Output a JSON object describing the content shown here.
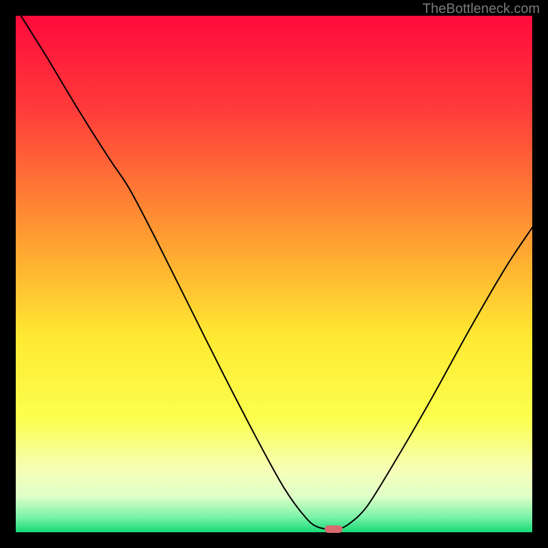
{
  "watermark": "TheBottleneck.com",
  "chart_data": {
    "type": "line",
    "title": "",
    "xlabel": "",
    "ylabel": "",
    "xlim": [
      0,
      100
    ],
    "ylim": [
      0,
      100
    ],
    "gradient_stops": [
      {
        "offset": 0,
        "color": "#ff0a3c"
      },
      {
        "offset": 18,
        "color": "#ff3b3a"
      },
      {
        "offset": 45,
        "color": "#ffa531"
      },
      {
        "offset": 62,
        "color": "#ffe932"
      },
      {
        "offset": 78,
        "color": "#fbff4e"
      },
      {
        "offset": 88,
        "color": "#f6ffb8"
      },
      {
        "offset": 93,
        "color": "#e0ffc8"
      },
      {
        "offset": 97,
        "color": "#7cf3a8"
      },
      {
        "offset": 100,
        "color": "#17d977"
      }
    ],
    "series": [
      {
        "name": "curve",
        "color": "#000000",
        "stroke_width": 2,
        "points": [
          {
            "x": 1.0,
            "y": 100.0
          },
          {
            "x": 6.0,
            "y": 92.0
          },
          {
            "x": 12.0,
            "y": 82.0
          },
          {
            "x": 18.0,
            "y": 72.5
          },
          {
            "x": 22.0,
            "y": 66.5
          },
          {
            "x": 27.0,
            "y": 57.0
          },
          {
            "x": 33.0,
            "y": 45.0
          },
          {
            "x": 40.0,
            "y": 31.0
          },
          {
            "x": 47.0,
            "y": 17.5
          },
          {
            "x": 52.0,
            "y": 8.5
          },
          {
            "x": 56.0,
            "y": 3.0
          },
          {
            "x": 58.5,
            "y": 1.0
          },
          {
            "x": 62.0,
            "y": 0.6
          },
          {
            "x": 64.5,
            "y": 1.6
          },
          {
            "x": 68.0,
            "y": 5.0
          },
          {
            "x": 73.0,
            "y": 13.0
          },
          {
            "x": 80.0,
            "y": 25.0
          },
          {
            "x": 88.0,
            "y": 39.5
          },
          {
            "x": 95.0,
            "y": 51.5
          },
          {
            "x": 100.0,
            "y": 59.0
          }
        ]
      }
    ],
    "marker": {
      "name": "bottleneck-marker",
      "shape": "rounded-rect",
      "color": "#d96a6f",
      "x": 61.5,
      "y": 0.6,
      "width_pct": 3.4,
      "height_pct": 1.4
    }
  }
}
